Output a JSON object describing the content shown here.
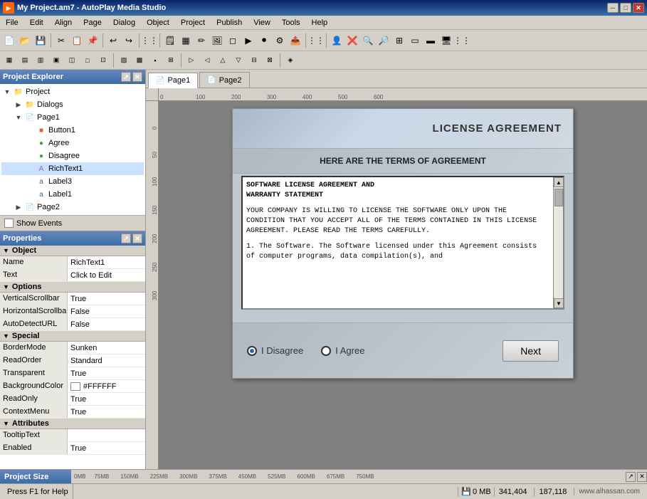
{
  "titlebar": {
    "title": "My Project.am7 - AutoPlay Media Studio",
    "icon": "AP",
    "buttons": [
      "minimize",
      "restore",
      "close"
    ]
  },
  "menubar": {
    "items": [
      "File",
      "Edit",
      "Align",
      "Page",
      "Dialog",
      "Object",
      "Project",
      "Publish",
      "View",
      "Tools",
      "Help"
    ]
  },
  "tabs": [
    {
      "label": "Page1",
      "active": true
    },
    {
      "label": "Page2",
      "active": false
    }
  ],
  "project_tree": {
    "items": [
      {
        "label": "Project",
        "type": "root",
        "indent": 0,
        "expanded": true
      },
      {
        "label": "Dialogs",
        "type": "folder",
        "indent": 1,
        "expanded": false
      },
      {
        "label": "Page1",
        "type": "page",
        "indent": 1,
        "expanded": true
      },
      {
        "label": "Button1",
        "type": "button",
        "indent": 2
      },
      {
        "label": "Agree",
        "type": "radio",
        "indent": 2
      },
      {
        "label": "Disagree",
        "type": "radio",
        "indent": 2
      },
      {
        "label": "RichText1",
        "type": "text",
        "indent": 2
      },
      {
        "label": "Label3",
        "type": "label",
        "indent": 2
      },
      {
        "label": "Label1",
        "type": "label",
        "indent": 2
      },
      {
        "label": "Page2",
        "type": "page",
        "indent": 1,
        "expanded": false
      }
    ]
  },
  "show_events": "Show Events",
  "properties": {
    "title": "Properties",
    "sections": [
      {
        "name": "Object",
        "rows": [
          {
            "name": "Name",
            "value": "RichText1"
          },
          {
            "name": "Text",
            "value": "Click to Edit"
          }
        ]
      },
      {
        "name": "Options",
        "rows": [
          {
            "name": "VerticalScrollbar",
            "value": "True"
          },
          {
            "name": "HorizontalScrollba",
            "value": "False"
          },
          {
            "name": "AutoDetectURL",
            "value": "False"
          }
        ]
      },
      {
        "name": "Special",
        "rows": [
          {
            "name": "BorderMode",
            "value": "Sunken"
          },
          {
            "name": "ReadOrder",
            "value": "Standard"
          },
          {
            "name": "Transparent",
            "value": "True"
          },
          {
            "name": "BackgroundColor",
            "value": "#FFFFFF",
            "has_swatch": true,
            "swatch_color": "#FFFFFF"
          },
          {
            "name": "ReadOnly",
            "value": "True"
          },
          {
            "name": "ContextMenu",
            "value": "True"
          }
        ]
      },
      {
        "name": "Attributes",
        "rows": [
          {
            "name": "TooltipText",
            "value": ""
          },
          {
            "name": "Enabled",
            "value": "True"
          }
        ]
      }
    ]
  },
  "canvas": {
    "license_header": "LICENSE AGREEMENT",
    "license_subheader": "HERE ARE THE TERMS OF AGREEMENT",
    "license_text_line1": "SOFTWARE LICENSE AGREEMENT AND",
    "license_text_line2": "WARRANTY STATEMENT",
    "license_body": "YOUR COMPANY IS WILLING TO LICENSE THE SOFTWARE ONLY UPON THE CONDITION THAT YOU ACCEPT ALL OF THE TERMS CONTAINED IN THIS LICENSE AGREEMENT.  PLEASE READ THE TERMS CAREFULLY.",
    "license_item1": "1. The Software.  The Software licensed under this Agreement consists of computer programs, data compilation(s), and",
    "radio1_label": "I Disagree",
    "radio2_label": "I Agree",
    "next_button": "Next"
  },
  "ruler": {
    "marks": [
      "0",
      "100",
      "200",
      "300",
      "400",
      "500",
      "600"
    ]
  },
  "statusbar": {
    "press_f1": "Press F1 for Help",
    "size": "0 MB",
    "coords1": "341,404",
    "coords2": "187,118",
    "watermark": "www.alhassan.com"
  },
  "projsize": {
    "title": "Project Size",
    "marks": [
      "0MB",
      "75MB",
      "150MB",
      "225MB",
      "300MB",
      "375MB",
      "450MB",
      "525MB",
      "600MB",
      "675MB",
      "750MB"
    ]
  }
}
